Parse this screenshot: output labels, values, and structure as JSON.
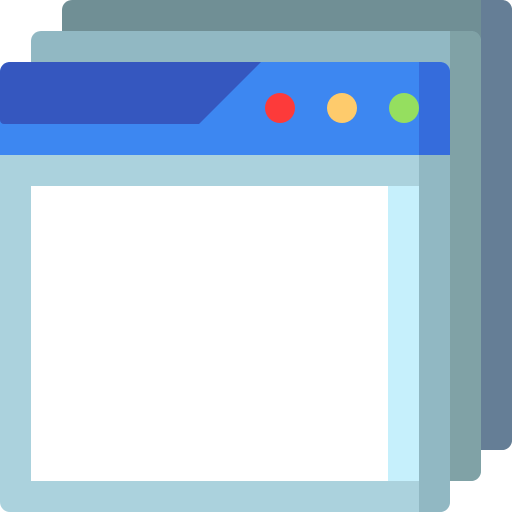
{
  "icon": {
    "name": "stacked-browser-windows-icon",
    "window_count": 3,
    "title_bar_dots": [
      "close-dot",
      "minimize-dot",
      "maximize-dot"
    ]
  },
  "colors": {
    "back_window": "#708f95",
    "back_window_shadow": "#657e96",
    "middle_window": "#91b8c3",
    "middle_window_shadow": "#80a2a6",
    "front_window_frame": "#abd2dd",
    "front_window_frame_shadow": "#91b8c3",
    "title_bar": "#3d87f1",
    "title_bar_dark": "#3557bf",
    "title_bar_edge": "#356cdc",
    "content_area": "#ffffff",
    "content_edge": "#c6f0fc",
    "dot_red": "#fd3a3a",
    "dot_yellow": "#fecb6c",
    "dot_green": "#95df5f"
  }
}
